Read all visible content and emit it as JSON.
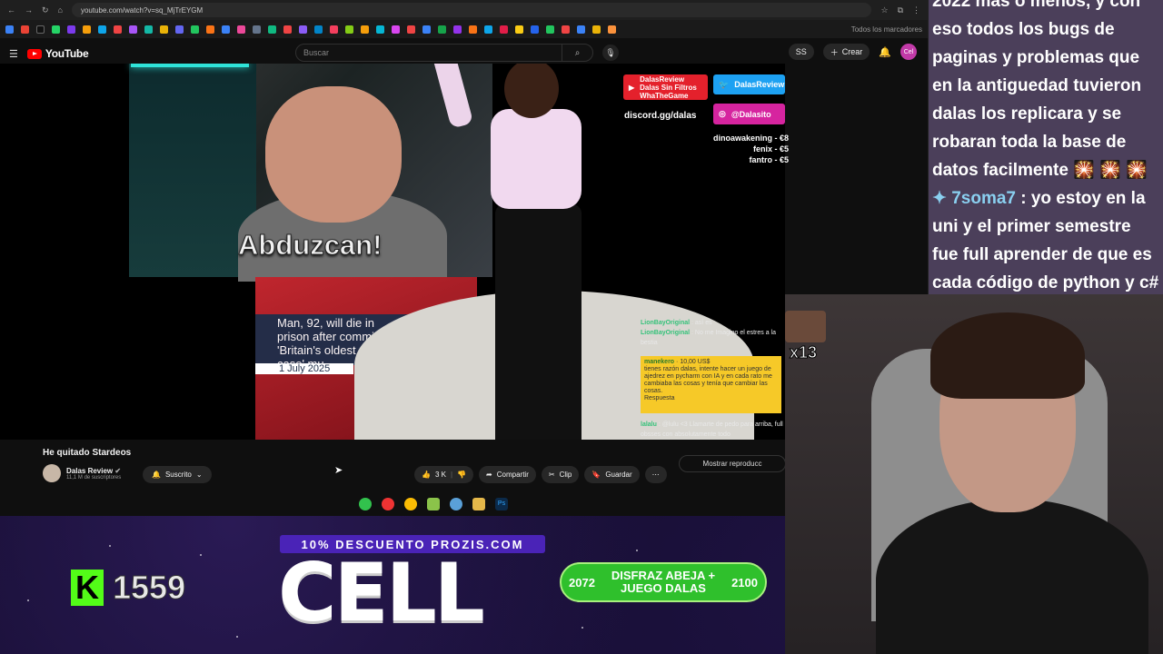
{
  "browser": {
    "url": "youtube.com/watch?v=sq_MjTrEYGM",
    "bookmarks_more": "Todos los marcadores"
  },
  "youtube": {
    "logo": "YouTube",
    "search_placeholder": "Buscar",
    "create_label": "Crear",
    "avatar_text": "Cel",
    "chip_text": "SS"
  },
  "video_overlay": {
    "abduz_caption": "Abduzcan!",
    "news_headline": "Man, 92, will die in prison after committing 'Britain's oldest cold case' mu",
    "news_date": "1 July 2025",
    "youtube_social": "DalasReview\nDalas Sin Filtros\nWhaTheGame",
    "twitter_social": "DalasReview",
    "instagram_social": "@Dalasito",
    "discord": "discord.gg/dalas",
    "donations": [
      "dinoawakening - €8",
      "fenix - €5",
      "fantro - €5"
    ],
    "chat_lines": [
      {
        "name": "LionBayOriginal",
        "text": ": así es"
      },
      {
        "name": "LionBayOriginal",
        "text": ": No me Imagino el estres a la bestia"
      },
      {
        "name": "lalalu",
        "text": ": @lulu <3 Llamarte de pedo para arriba, full obsses con absolutamente todo"
      }
    ],
    "superchat_name": "manekero",
    "superchat_amount": "10,00 US$",
    "superchat_text": "tienes razón dalas, intente hacer un juego de ajedrez en pycharm con IA y en cada rato me cambiaba las cosas y tenía que cambiar las cosas.",
    "superchat_reply": "Respuesta"
  },
  "video_info": {
    "title": "He quitado Stardeos",
    "channel": "Dalas Review",
    "subscribers": "11,1 M de suscriptores",
    "subscribed_label": "Suscrito",
    "likes": "3 K",
    "share_label": "Compartir",
    "clip_label": "Clip",
    "save_label": "Guardar",
    "show_replay": "Mostrar reproducc"
  },
  "stream_chat": {
    "lines": [
      {
        "user": "",
        "text": "2022 más o menos, y con eso todos los bugs de paginas y problemas que en la antiguedad tuvieron dalas los replicara y se robaran toda la base de datos facilmente 🎇 🎇 🎇"
      },
      {
        "user": "✦ 7soma7",
        "text": ": yo estoy en la uni y el primer semestre fue full aprender de que es cada código de python y c#"
      }
    ],
    "emote_count": "x13"
  },
  "bottom": {
    "kick_count": "1559",
    "promo": "10% DESCUENTO PROZIS.COM",
    "big_word": "CELL",
    "goal_left": "2072",
    "goal_text": "DISFRAZ ABEJA + JUEGO DALAS",
    "goal_right": "2100"
  }
}
